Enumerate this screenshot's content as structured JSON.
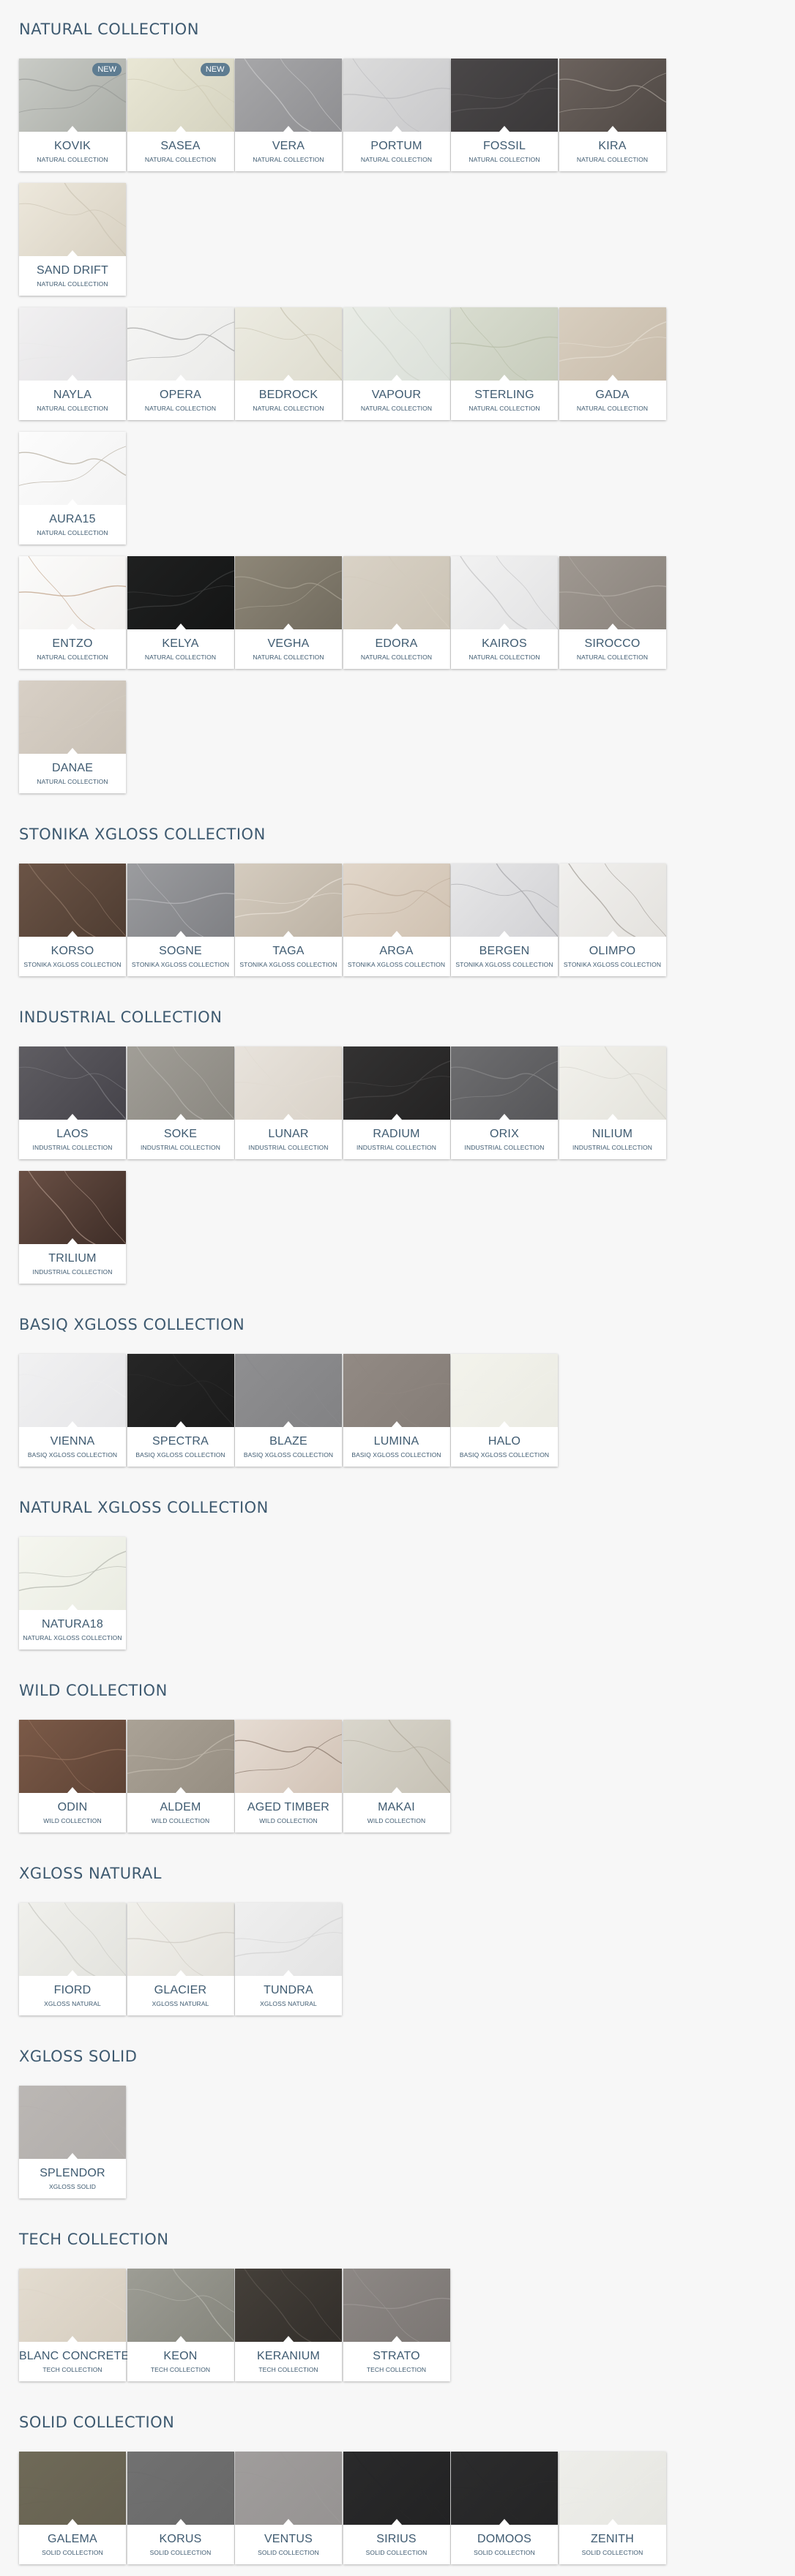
{
  "collections": [
    {
      "title": "NATURAL COLLECTION",
      "items": [
        {
          "name": "KOVIK",
          "sub": "NATURAL COLLECTION",
          "badge": "NEW",
          "colors": [
            "#c9cbc6",
            "#a9aca6"
          ],
          "vein": "#9a9c98"
        },
        {
          "name": "SASEA",
          "sub": "NATURAL COLLECTION",
          "badge": "NEW",
          "colors": [
            "#e9e7d5",
            "#d5d3c0"
          ],
          "vein": "#cfccb7"
        },
        {
          "name": "VERA",
          "sub": "NATURAL COLLECTION",
          "colors": [
            "#a7a7a9",
            "#8f8f92"
          ],
          "vein": "#c4c4c6"
        },
        {
          "name": "PORTUM",
          "sub": "NATURAL COLLECTION",
          "colors": [
            "#dcdcdc",
            "#c9c9cb"
          ],
          "vein": "#bcbcbe"
        },
        {
          "name": "FOSSIL",
          "sub": "NATURAL COLLECTION",
          "colors": [
            "#4a4748",
            "#3a3839"
          ],
          "vein": "#5b5859"
        },
        {
          "name": "KIRA",
          "sub": "NATURAL COLLECTION",
          "colors": [
            "#6b625d",
            "#4f4844"
          ],
          "vein": "#9b938c"
        },
        {
          "name": "SAND DRIFT",
          "sub": "NATURAL COLLECTION",
          "colors": [
            "#ede8dc",
            "#d8d1c2"
          ],
          "vein": "#cdc5b5"
        }
      ]
    },
    {
      "title": "",
      "items": [
        {
          "name": "NAYLA",
          "sub": "NATURAL COLLECTION",
          "colors": [
            "#f1f0f1",
            "#e3e2e4"
          ],
          "vein": "#e9e8e9"
        },
        {
          "name": "OPERA",
          "sub": "NATURAL COLLECTION",
          "colors": [
            "#f5f5f4",
            "#ebebe9"
          ],
          "vein": "#a9a9a7"
        },
        {
          "name": "BEDROCK",
          "sub": "NATURAL COLLECTION",
          "colors": [
            "#ecebe1",
            "#dedccf"
          ],
          "vein": "#c9c5b4"
        },
        {
          "name": "VAPOUR",
          "sub": "NATURAL COLLECTION",
          "colors": [
            "#e9ece6",
            "#dbe0d9"
          ],
          "vein": "#cfd4cc"
        },
        {
          "name": "STERLING",
          "sub": "NATURAL COLLECTION",
          "colors": [
            "#d9ddd0",
            "#c7ccbc"
          ],
          "vein": "#b8bea9"
        },
        {
          "name": "GADA",
          "sub": "NATURAL COLLECTION",
          "colors": [
            "#d8cebf",
            "#c8bcab"
          ],
          "vein": "#e4dccf"
        },
        {
          "name": "AURA15",
          "sub": "NATURAL COLLECTION",
          "colors": [
            "#fcfcfc",
            "#f3f3f3"
          ],
          "vein": "#b9b2a4"
        }
      ]
    },
    {
      "title": "",
      "items": [
        {
          "name": "ENTZO",
          "sub": "NATURAL COLLECTION",
          "colors": [
            "#fbfbfa",
            "#f2f0ee"
          ],
          "vein": "#c2a58c"
        },
        {
          "name": "KELYA",
          "sub": "NATURAL COLLECTION",
          "colors": [
            "#1f2020",
            "#141515"
          ],
          "vein": "#3b3c3c"
        },
        {
          "name": "VEGHA",
          "sub": "NATURAL COLLECTION",
          "colors": [
            "#8e8778",
            "#716b5e"
          ],
          "vein": "#a49d8f"
        },
        {
          "name": "EDORA",
          "sub": "NATURAL COLLECTION",
          "colors": [
            "#d9d2c6",
            "#cbc3b5"
          ],
          "vein": "#d2cabd"
        },
        {
          "name": "KAIROS",
          "sub": "NATURAL COLLECTION",
          "colors": [
            "#f2f2f2",
            "#e3e3e4"
          ],
          "vein": "#c4c4c6"
        },
        {
          "name": "SIROCCO",
          "sub": "NATURAL COLLECTION",
          "colors": [
            "#9f9891",
            "#8a837c"
          ],
          "vein": "#b1aba4"
        },
        {
          "name": "DANAE",
          "sub": "NATURAL COLLECTION",
          "colors": [
            "#d8d0c6",
            "#c9c1b6"
          ],
          "vein": "#d1c9bf"
        }
      ]
    },
    {
      "title": "STONIKA XGLOSS COLLECTION",
      "items": [
        {
          "name": "KORSO",
          "sub": "STONIKA XGLOSS COLLECTION",
          "colors": [
            "#6b5446",
            "#4f3d32"
          ],
          "vein": "#8a7262"
        },
        {
          "name": "SOGNE",
          "sub": "STONIKA XGLOSS COLLECTION",
          "colors": [
            "#9b9c9f",
            "#7f8084"
          ],
          "vein": "#b6b7ba"
        },
        {
          "name": "TAGA",
          "sub": "STONIKA XGLOSS COLLECTION",
          "colors": [
            "#d4cbbe",
            "#bdb3a5"
          ],
          "vein": "#e6dfd4"
        },
        {
          "name": "ARGA",
          "sub": "STONIKA XGLOSS COLLECTION",
          "colors": [
            "#e1d6c9",
            "#d0c2b2"
          ],
          "vein": "#bfae9c"
        },
        {
          "name": "BERGEN",
          "sub": "STONIKA XGLOSS COLLECTION",
          "colors": [
            "#e7e7e8",
            "#d2d2d5"
          ],
          "vein": "#a9a9ad"
        },
        {
          "name": "OLIMPO",
          "sub": "STONIKA XGLOSS COLLECTION",
          "colors": [
            "#f1f0ee",
            "#e4e2de"
          ],
          "vein": "#a7a39c"
        }
      ]
    },
    {
      "title": "INDUSTRIAL COLLECTION",
      "items": [
        {
          "name": "LAOS",
          "sub": "INDUSTRIAL COLLECTION",
          "colors": [
            "#5f5d62",
            "#45434a"
          ],
          "vein": "#77757a"
        },
        {
          "name": "SOKE",
          "sub": "INDUSTRIAL COLLECTION",
          "colors": [
            "#a19e97",
            "#8b8881"
          ],
          "vein": "#b2afa9"
        },
        {
          "name": "LUNAR",
          "sub": "INDUSTRIAL COLLECTION",
          "colors": [
            "#e8e3dc",
            "#d9d2c8"
          ],
          "vein": "#e1dbd2"
        },
        {
          "name": "RADIUM",
          "sub": "INDUSTRIAL COLLECTION",
          "colors": [
            "#333232",
            "#242323"
          ],
          "vein": "#454444"
        },
        {
          "name": "ORIX",
          "sub": "INDUSTRIAL COLLECTION",
          "colors": [
            "#6e6e70",
            "#565659"
          ],
          "vein": "#848486"
        },
        {
          "name": "NILIUM",
          "sub": "INDUSTRIAL COLLECTION",
          "colors": [
            "#f2f1ec",
            "#e4e3dc"
          ],
          "vein": "#d6d5cd"
        },
        {
          "name": "TRILIUM",
          "sub": "INDUSTRIAL COLLECTION",
          "colors": [
            "#6a5045",
            "#3e2d27"
          ],
          "vein": "#a38a7d"
        }
      ]
    },
    {
      "title": "BASIQ XGLOSS COLLECTION",
      "items": [
        {
          "name": "VIENNA",
          "sub": "BASIQ XGLOSS COLLECTION",
          "colors": [
            "#f1f1f2",
            "#e6e6e8"
          ],
          "vein": "#ececee"
        },
        {
          "name": "SPECTRA",
          "sub": "BASIQ XGLOSS COLLECTION",
          "colors": [
            "#262626",
            "#1b1b1b"
          ],
          "vein": "#2c2c2c"
        },
        {
          "name": "BLAZE",
          "sub": "BASIQ XGLOSS COLLECTION",
          "colors": [
            "#8f8f91",
            "#828284"
          ],
          "vein": "#8a8a8c"
        },
        {
          "name": "LUMINA",
          "sub": "BASIQ XGLOSS COLLECTION",
          "colors": [
            "#928a84",
            "#857d77"
          ],
          "vein": "#8e8680"
        },
        {
          "name": "HALO",
          "sub": "BASIQ XGLOSS COLLECTION",
          "colors": [
            "#f3f3ec",
            "#ebebe3"
          ],
          "vein": "#efefe8"
        }
      ]
    },
    {
      "title": "NATURAL XGLOSS COLLECTION",
      "items": [
        {
          "name": "NATURA18",
          "sub": "NATURAL XGLOSS COLLECTION",
          "colors": [
            "#f5f6ef",
            "#eaece2"
          ],
          "vein": "#b7b9b0"
        }
      ]
    },
    {
      "title": "WILD COLLECTION",
      "items": [
        {
          "name": "ODIN",
          "sub": "WILD COLLECTION",
          "colors": [
            "#7b5a48",
            "#5e4335"
          ],
          "vein": "#94715d"
        },
        {
          "name": "ALDEM",
          "sub": "WILD COLLECTION",
          "colors": [
            "#aaa296",
            "#968e82"
          ],
          "vein": "#c1b9ad"
        },
        {
          "name": "AGED TIMBER",
          "sub": "WILD COLLECTION",
          "colors": [
            "#e6dcd3",
            "#d2c3b6"
          ],
          "vein": "#8c7b6e"
        },
        {
          "name": "MAKAI",
          "sub": "WILD COLLECTION",
          "colors": [
            "#d9d6cc",
            "#c7c2b6"
          ],
          "vein": "#b3ad9f"
        }
      ]
    },
    {
      "title": "XGLOSS NATURAL",
      "items": [
        {
          "name": "FIORD",
          "sub": "XGLOSS NATURAL",
          "colors": [
            "#f0f0ec",
            "#e3e3de"
          ],
          "vein": "#cacac4"
        },
        {
          "name": "GLACIER",
          "sub": "XGLOSS NATURAL",
          "colors": [
            "#f1f0eb",
            "#e4e2dc"
          ],
          "vein": "#cfccc4"
        },
        {
          "name": "TUNDRA",
          "sub": "XGLOSS NATURAL",
          "colors": [
            "#efefef",
            "#e4e4e4"
          ],
          "vein": "#d2d2d2"
        }
      ]
    },
    {
      "title": "XGLOSS SOLID",
      "items": [
        {
          "name": "SPLENDOR",
          "sub": "XGLOSS SOLID",
          "colors": [
            "#bbb7b4",
            "#b1adaa"
          ],
          "vein": "#b6b2af"
        }
      ]
    },
    {
      "title": "TECH COLLECTION",
      "items": [
        {
          "name": "BLANC CONCRETE",
          "sub": "TECH COLLECTION",
          "colors": [
            "#e3dcd0",
            "#d6cdbf"
          ],
          "vein": "#ddd5c8"
        },
        {
          "name": "KEON",
          "sub": "TECH COLLECTION",
          "colors": [
            "#9d9d95",
            "#85857c"
          ],
          "vein": "#b0b0a8"
        },
        {
          "name": "KERANIUM",
          "sub": "TECH COLLECTION",
          "colors": [
            "#45403a",
            "#322e2a"
          ],
          "vein": "#5a544d"
        },
        {
          "name": "STRATO",
          "sub": "TECH COLLECTION",
          "colors": [
            "#8d8885",
            "#7b7673"
          ],
          "vein": "#9b9693"
        }
      ]
    },
    {
      "title": "SOLID COLLECTION",
      "items": [
        {
          "name": "GALEMA",
          "sub": "SOLID COLLECTION",
          "colors": [
            "#6f6a58",
            "#656050"
          ],
          "vein": "#6a6554"
        },
        {
          "name": "KORUS",
          "sub": "SOLID COLLECTION",
          "colors": [
            "#717171",
            "#686868"
          ],
          "vein": "#6d6d6d"
        },
        {
          "name": "VENTUS",
          "sub": "SOLID COLLECTION",
          "colors": [
            "#a09d9c",
            "#969392"
          ],
          "vein": "#9b9897"
        },
        {
          "name": "SIRIUS",
          "sub": "SOLID COLLECTION",
          "colors": [
            "#2a2a2b",
            "#222223"
          ],
          "vein": "#272728"
        },
        {
          "name": "DOMOOS",
          "sub": "SOLID COLLECTION",
          "colors": [
            "#2c2c2d",
            "#242425"
          ],
          "vein": "#29292a"
        },
        {
          "name": "ZENITH",
          "sub": "SOLID COLLECTION",
          "colors": [
            "#eeeeea",
            "#e6e6e1"
          ],
          "vein": "#eaeae6"
        }
      ]
    }
  ]
}
